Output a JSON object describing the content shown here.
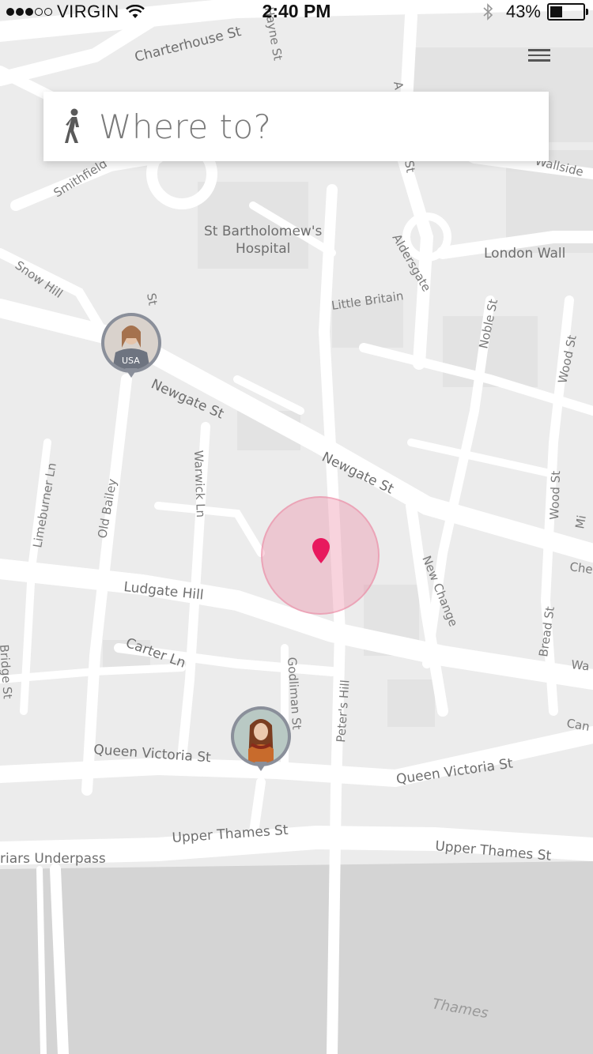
{
  "status_bar": {
    "carrier": "VIRGIN",
    "time": "2:40 PM",
    "battery_percent_text": "43%",
    "battery_level": 0.43,
    "signal_bars_filled": 3,
    "signal_bars_total": 5
  },
  "search": {
    "placeholder": "Where to?",
    "mode_icon": "walking-person-icon"
  },
  "menu": {
    "icon": "hamburger-menu-icon"
  },
  "map": {
    "streets": [
      "Charterhouse St",
      "Hayne St",
      "Smithfield",
      "Wallside",
      "St Bartholomew's",
      "Hospital",
      "London Wall",
      "Snow Hill",
      "Aldersgate",
      "Little Britain",
      "Noble St",
      "Wood St",
      "Newgate St",
      "Newgate St",
      "Limeburner Ln",
      "Old Bailey",
      "Warwick Ln",
      "Wood St",
      "Ludgate Hill",
      "New Change",
      "Bread St",
      "Carter Ln",
      "Godliman St",
      "Peter's Hill",
      "Queen Victoria St",
      "Queen Victoria St",
      "Upper Thames St",
      "Upper Thames St",
      "riars Underpass",
      "Thames",
      "St",
      "St",
      "A",
      "Che",
      "Wa",
      "Can",
      "Mi",
      "Bridge St"
    ],
    "colors": {
      "background": "#ededed",
      "road": "#ffffff",
      "river": "#d4d4d4",
      "location_accent": "#e8195e",
      "halo": "#f3c2cf"
    }
  },
  "markers": {
    "user_a": {
      "icon": "avatar-user-usa-shirt"
    },
    "user_b": {
      "icon": "avatar-user-scarf"
    },
    "current_location": {
      "icon": "location-pin-icon"
    }
  }
}
